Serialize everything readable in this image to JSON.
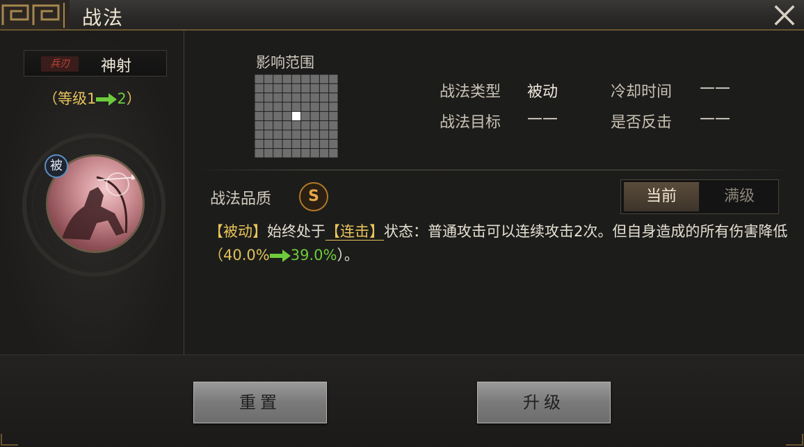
{
  "window": {
    "title": "战法"
  },
  "skill": {
    "type_tag": "兵刃",
    "name": "神射",
    "level_open": "（等级",
    "level_from": "1",
    "level_to": "2",
    "level_close": "）",
    "passive_badge": "被"
  },
  "range": {
    "label": "影响范围",
    "grid_size": 9,
    "highlight_cell": [
      4,
      4
    ]
  },
  "stats": [
    {
      "label": "战法类型",
      "value": "被动"
    },
    {
      "label": "冷却时间",
      "value": "——"
    },
    {
      "label": "战法目标",
      "value": "——"
    },
    {
      "label": "是否反击",
      "value": "——"
    }
  ],
  "quality": {
    "label": "战法品质",
    "grade": "S"
  },
  "toggle": {
    "current": "当前",
    "max": "满级"
  },
  "description": {
    "tag": "【被动】",
    "part1": "始终处于",
    "keyword": "【连击】",
    "part2": "状态：普通攻击可以连续攻击2次。但自身造成的所有伤害降低",
    "paren_open": "（",
    "val_from": "40.0%",
    "val_to": "39.0%",
    "paren_close": "）。"
  },
  "buttons": {
    "reset": "重置",
    "upgrade": "升级"
  },
  "colors": {
    "gold": "#e8c45a",
    "green": "#6ecb3c",
    "accent_border": "#6a5530"
  }
}
